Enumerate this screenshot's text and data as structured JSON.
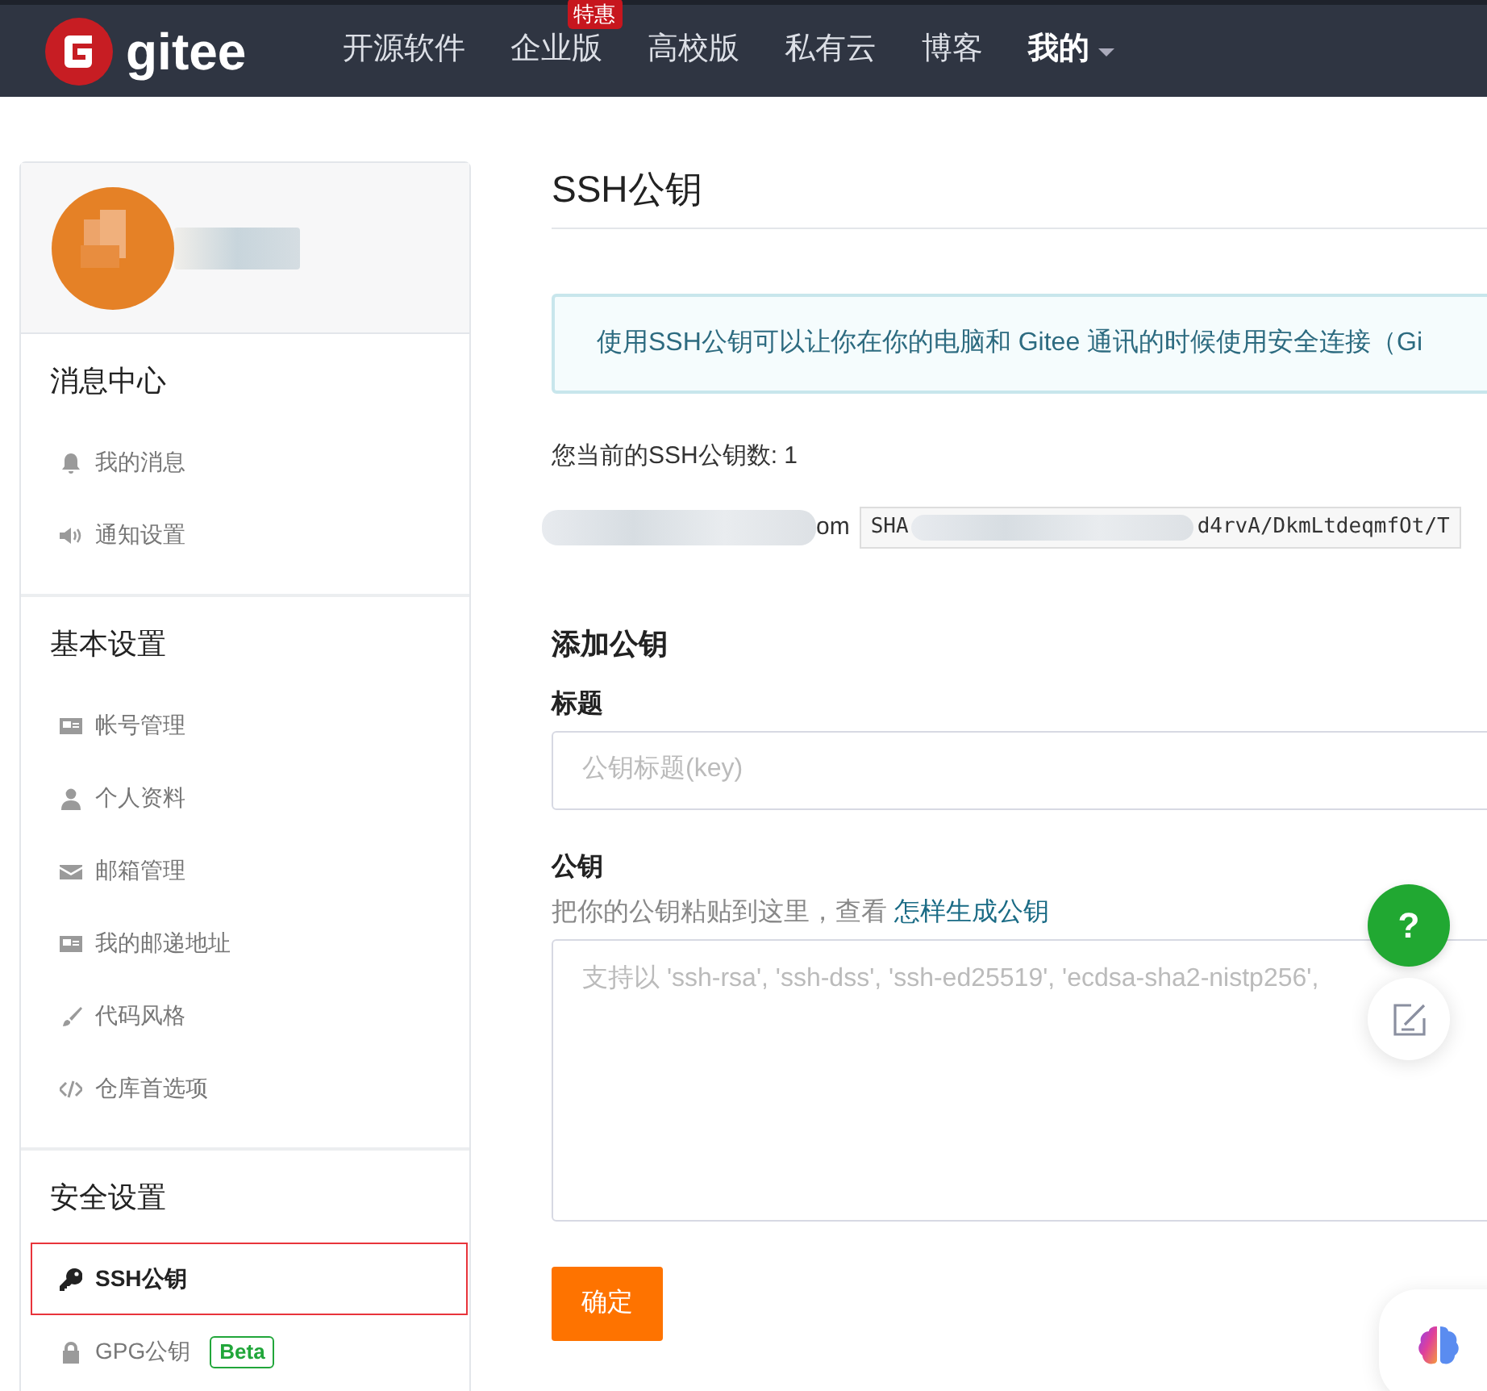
{
  "navbar": {
    "logo_text": "gitee",
    "items": [
      {
        "label": "开源软件",
        "dropdown": false,
        "emphasis": false
      },
      {
        "label": "企业版",
        "badge": "特惠",
        "dropdown": false,
        "emphasis": false
      },
      {
        "label": "高校版",
        "dropdown": false,
        "emphasis": false
      },
      {
        "label": "私有云",
        "dropdown": false,
        "emphasis": false
      },
      {
        "label": "博客",
        "dropdown": false,
        "emphasis": false
      },
      {
        "label": "我的",
        "dropdown": true,
        "emphasis": true
      }
    ]
  },
  "sidebar": {
    "sections": [
      {
        "title": "消息中心",
        "items": [
          {
            "label": "我的消息",
            "selected": false
          },
          {
            "label": "通知设置",
            "selected": false
          }
        ]
      },
      {
        "title": "基本设置",
        "items": [
          {
            "label": "帐号管理",
            "selected": false
          },
          {
            "label": "个人资料",
            "selected": false
          },
          {
            "label": "邮箱管理",
            "selected": false
          },
          {
            "label": "我的邮递地址",
            "selected": false
          },
          {
            "label": "代码风格",
            "selected": false
          },
          {
            "label": "仓库首选项",
            "selected": false
          }
        ]
      },
      {
        "title": "安全设置",
        "items": [
          {
            "label": "SSH公钥",
            "selected": true
          },
          {
            "label": "GPG公钥",
            "selected": false,
            "badge": "Beta"
          }
        ]
      }
    ]
  },
  "main": {
    "title": "SSH公钥",
    "notice": "使用SSH公钥可以让你在你的电脑和 Gitee 通讯的时候使用安全连接（Gi",
    "key_count": "您当前的SSH公钥数: 1",
    "key_entry": {
      "name_tail": "om",
      "fingerprint_head": "SHA",
      "fingerprint_tail": "d4rvA/DkmLtdeqmfOt/T"
    },
    "form": {
      "heading": "添加公钥",
      "title_label": "标题",
      "title_placeholder": "公钥标题(key)",
      "key_label": "公钥",
      "key_hint": "把你的公钥粘贴到这里，查看 ",
      "key_hint_link": "怎样生成公钥",
      "key_placeholder": "支持以 'ssh-rsa', 'ssh-dss', 'ssh-ed25519', 'ecdsa-sha2-nistp256',",
      "submit": "确定"
    }
  },
  "floating": {
    "help": "?"
  }
}
